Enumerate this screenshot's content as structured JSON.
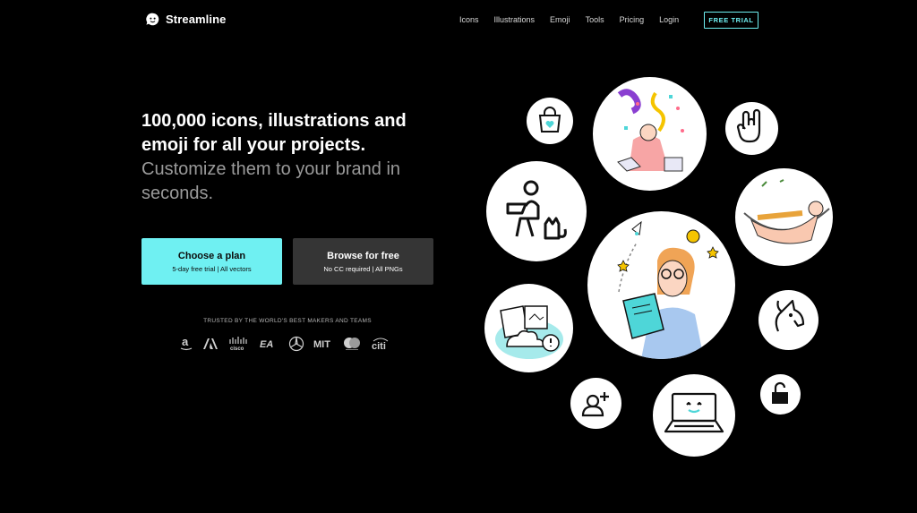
{
  "header": {
    "brand": "Streamline",
    "nav": [
      "Icons",
      "Illustrations",
      "Emoji",
      "Tools",
      "Pricing",
      "Login"
    ],
    "cta": "FREE TRIAL"
  },
  "hero": {
    "headline_line1": "100,000 icons, illustrations and",
    "headline_line2": "emoji for all your projects.",
    "subline": "Customize them to your brand in seconds.",
    "primary_button": {
      "title": "Choose a plan",
      "subtitle": "5-day free trial | All vectors"
    },
    "secondary_button": {
      "title": "Browse for free",
      "subtitle": "No CC required | All PNGs"
    },
    "trusted": "TRUSTED BY THE WORLD'S BEST MAKERS AND TEAMS",
    "brands": [
      "amazon-logo",
      "adobe-logo",
      "cisco-logo",
      "ea-logo",
      "mercedes-logo",
      "mit-logo",
      "mastercard-logo",
      "citi-logo"
    ]
  },
  "brand_text": {
    "cisco": "cisco",
    "ea": "EA",
    "mit": "MIT",
    "citi": "citi"
  },
  "colors": {
    "accent": "#6ff0f2",
    "background": "#000000",
    "secondary_button": "#353535"
  }
}
